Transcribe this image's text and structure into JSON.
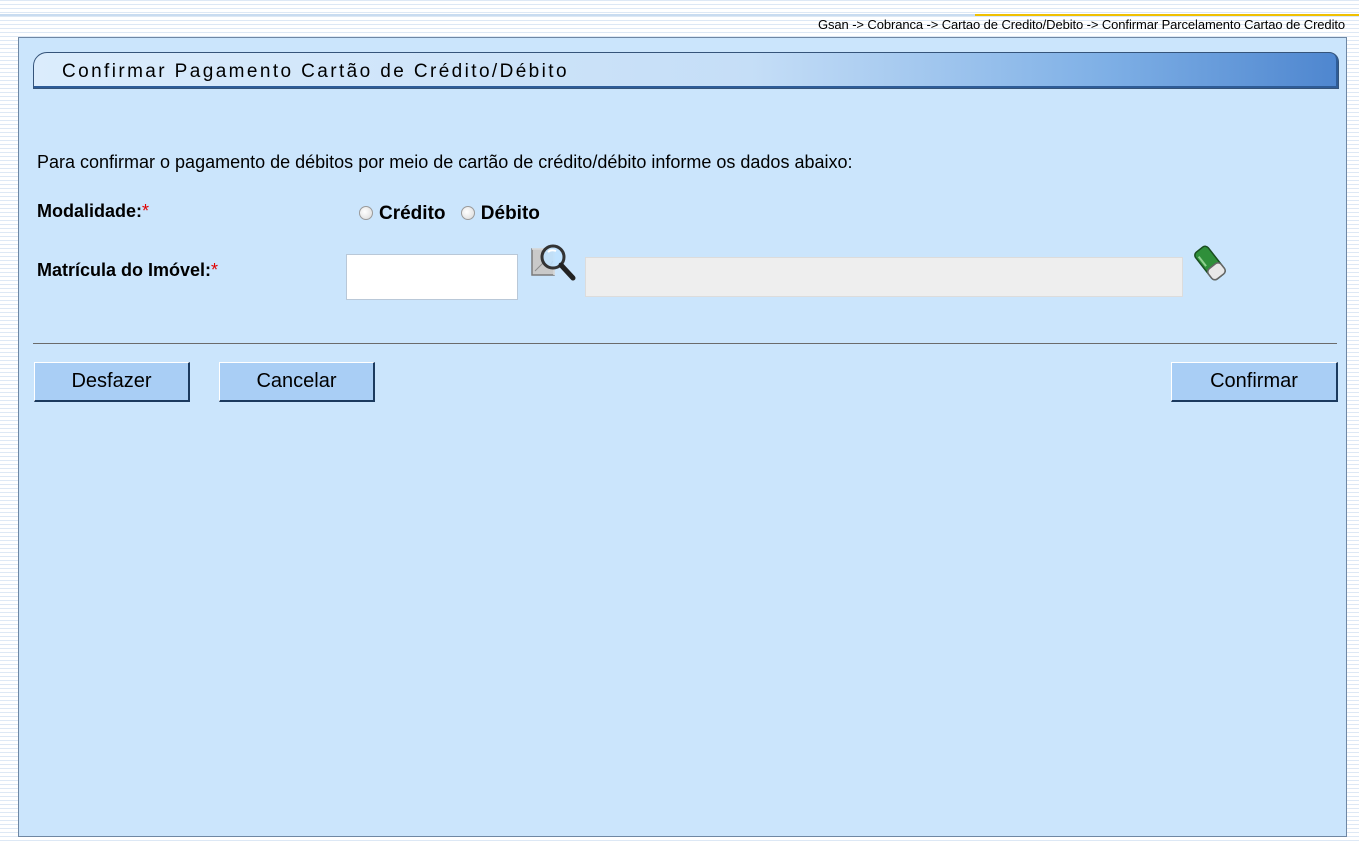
{
  "breadcrumb": "Gsan -> Cobranca -> Cartao de Credito/Debito -> Confirmar Parcelamento Cartao de Credito",
  "panel": {
    "title": "Confirmar Pagamento Cartão de Crédito/Débito",
    "instructions": "Para confirmar o pagamento de débitos por meio de cartão de crédito/débito informe os dados abaixo:"
  },
  "form": {
    "modalidade_label": "Modalidade:",
    "required_mark": "*",
    "options": [
      {
        "label": "Crédito",
        "selected": false
      },
      {
        "label": "Débito",
        "selected": false
      }
    ],
    "matricula_label": "Matrícula do Imóvel:",
    "matricula_value": "",
    "descricao_value": ""
  },
  "buttons": {
    "desfazer": "Desfazer",
    "cancelar": "Cancelar",
    "confirmar": "Confirmar"
  },
  "icons": {
    "search": "search-icon",
    "eraser": "eraser-icon"
  },
  "colors": {
    "panel_bg": "#cbe5fc",
    "button_bg": "#a9cef5",
    "required": "#e00000",
    "header_accent": "#4e86cf"
  }
}
